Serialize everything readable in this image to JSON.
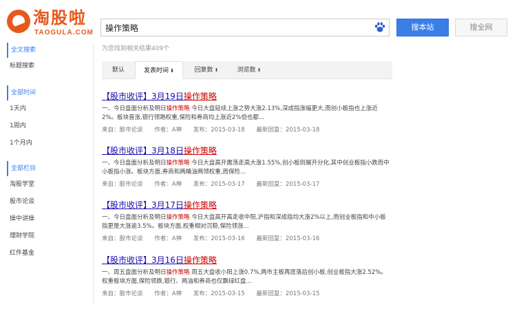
{
  "logo": {
    "cn": "淘股啦",
    "en": "TAOGULA.COM"
  },
  "search": {
    "value": "操作策略",
    "site_button": "搜本站",
    "web_button": "搜全网"
  },
  "result_count": "为您找到相关结果409个",
  "sidebar": {
    "groups": [
      {
        "head": "全文搜索",
        "items": [
          "标题搜索"
        ]
      },
      {
        "head": "全部时间",
        "items": [
          "1天内",
          "1周内",
          "1个月内"
        ]
      },
      {
        "head": "全部栏目",
        "items": [
          "淘股学堂",
          "股市论谈",
          "操中讲操",
          "理财学院",
          "红件基金"
        ]
      }
    ]
  },
  "tabs": [
    {
      "label": "默认",
      "caret": ""
    },
    {
      "label": "发表时间",
      "caret": "⬇"
    },
    {
      "label": "回复数",
      "caret": "⬇"
    },
    {
      "label": "浏览数",
      "caret": "⬇"
    }
  ],
  "results": [
    {
      "title_main": "【股市收评】3月19日",
      "title_hl": "操作策略",
      "snippet_a": "一、今日盘面分析及明日",
      "snippet_hl": "操作策略",
      "snippet_b": "今日大盘延续上涨之势大涨2.13%,深成指涨幅更大,而创小板指也上涨近2%。板块普涨,银行领跑权重,保险和券商均上涨近2%但也都...",
      "source": "来自：股市论谈",
      "author": "作者：A神",
      "published": "发布：2015-03-18",
      "replied": "最新回复：2015-03-18"
    },
    {
      "title_main": "【股市收评】3月18日",
      "title_hl": "操作策略",
      "snippet_a": "一、今日盘面分析及明日",
      "snippet_hl": "操作策略",
      "snippet_b": "今日大盘高开震荡走高大涨1.55%,创小板则展开分化,其中创业板指小跌而中小板指小涨。板块方面,券商和两桶油两领权重,而保险...",
      "source": "来自：股市论谈",
      "author": "作者：A神",
      "published": "发布：2015-03-17",
      "replied": "最新回复：2015-03-17"
    },
    {
      "title_main": "【股市收评】3月17日",
      "title_hl": "操作策略",
      "snippet_a": "一、今日盘面分析及明日",
      "snippet_hl": "操作策略",
      "snippet_b": "今日大盘高开高走收中阳,沪指和深成指均大涨2%以上,而创业板指和中小板指更是大涨逾3.5%。板块方面,权重相对沉稳,保险领涨...",
      "source": "来自：股市论谈",
      "author": "作者：A神",
      "published": "发布：2015-03-16",
      "replied": "最新回复：2015-03-16"
    },
    {
      "title_main": "【股市收评】3月16日",
      "title_hl": "操作策略",
      "snippet_a": "一、周五盘面分析及明日",
      "snippet_hl": "操作策略",
      "snippet_b": "周五大盘收小阳上涨0.7%,两市主板再度落后创小板,创业板指大涨2.52%。权重板块方面,保险领跌,银行、两油和券商也仅飘绿红盘...",
      "source": "来自：股市论谈",
      "author": "作者：A神",
      "published": "发布：2015-03-15",
      "replied": "最新回复：2015-03-15"
    }
  ]
}
